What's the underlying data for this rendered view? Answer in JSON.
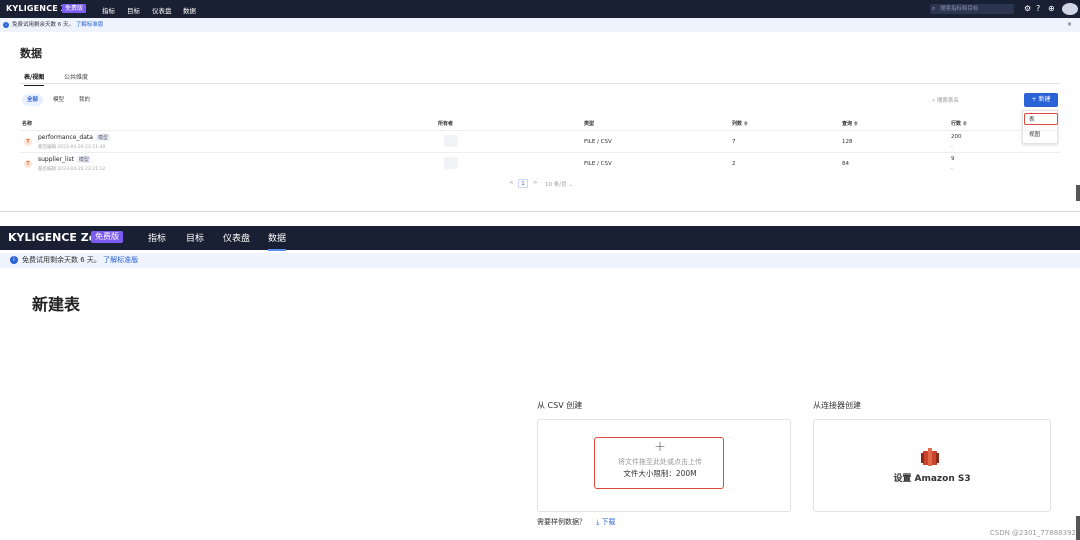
{
  "brand": {
    "name": "KYLIGENCE Zen",
    "edition_badge": "免费版"
  },
  "nav": {
    "items": [
      "指标",
      "目标",
      "仪表盘",
      "数据"
    ],
    "active": "数据"
  },
  "top_search": {
    "placeholder": "搜索指标和目标"
  },
  "trial_banner": {
    "text": "免费试用剩余天数 6 天。",
    "link": "了解标准版",
    "close": "×"
  },
  "data_page": {
    "title": "数据",
    "tabs": [
      "表/视图",
      "公共维度"
    ],
    "filters": [
      "全部",
      "模型",
      "我的"
    ],
    "search_placeholder": "搜索表名",
    "new_button": "+ 新建",
    "new_menu": [
      "表",
      "视图"
    ],
    "columns": [
      "名称",
      "所有者",
      "类型",
      "列数 ≑",
      "查询 ≑",
      "行数 ≑"
    ],
    "rows": [
      {
        "icon": "T",
        "name": "performance_data",
        "tag": "模型",
        "meta": "最后编辑 2023-04-26 23:21:49",
        "type": "FILE / CSV",
        "cols": "7",
        "queries": "128",
        "rows": "200",
        "rows_sub": "-"
      },
      {
        "icon": "T",
        "name": "supplier_list",
        "tag": "模型",
        "meta": "最后编辑 2023-04-26 23:21:12",
        "type": "FILE / CSV",
        "cols": "2",
        "queries": "84",
        "rows": "9",
        "rows_sub": "-"
      }
    ],
    "pagination": {
      "prev": "<",
      "current": "1",
      "next": ">",
      "page_size": "10 条/页 ⌄"
    }
  },
  "new_table_page": {
    "title": "新建表",
    "csv_section": "从 CSV 创建",
    "connector_section": "从连接器创建",
    "upload_plus": "+",
    "upload_hint": "将文件拖至此处或点击上传",
    "upload_limit": "文件大小限制：200M",
    "connector_label": "设置 Amazon S3",
    "sample_question": "需要样例数据？",
    "download": "⤓ 下载"
  },
  "watermark": "CSDN @2301_77888392",
  "colors": {
    "nav_bg": "#1a2033",
    "accent": "#2a63d6",
    "badge": "#7b5cf0",
    "highlight": "#e04a3a",
    "s3": "#c7452c"
  }
}
